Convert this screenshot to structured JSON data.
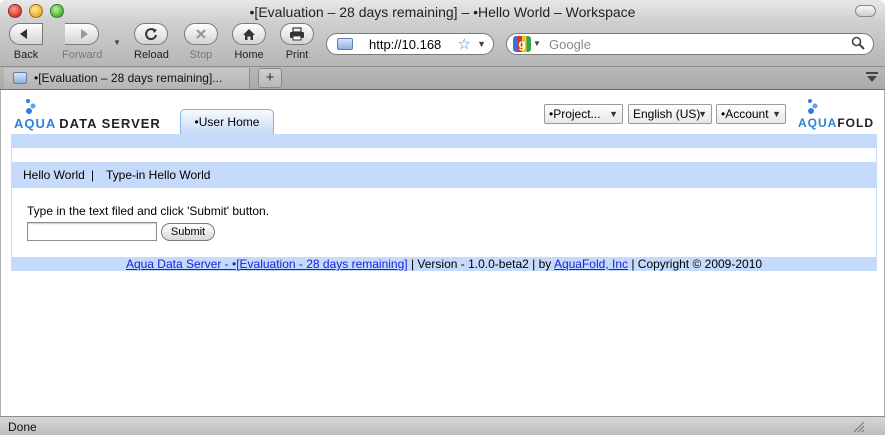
{
  "window": {
    "title": "•[Evaluation – 28 days remaining] – •Hello World – Workspace"
  },
  "toolbar": {
    "back_label": "Back",
    "forward_label": "Forward",
    "reload_label": "Reload",
    "stop_label": "Stop",
    "home_label": "Home",
    "print_label": "Print"
  },
  "address": {
    "url": "http://10.168"
  },
  "search": {
    "placeholder": "Google",
    "engine_letter": "g"
  },
  "tabs": [
    {
      "label": "•[Evaluation – 28 days remaining]..."
    }
  ],
  "newtab_label": "+",
  "app": {
    "logo_left": {
      "part1": "AQUA",
      "part2": "DATA SERVER"
    },
    "logo_right": {
      "part1": "AQUA",
      "part2": "FOLD"
    },
    "user_home_tab": "•User Home",
    "project_select": "•Project...",
    "language_select": "English (US)",
    "account_select": "•Account",
    "nav": {
      "link1": "Hello World",
      "separator": "|",
      "link2": "Type-in Hello World"
    },
    "form": {
      "instruction": "Type in the text filed and click 'Submit' button.",
      "input_value": "",
      "submit_label": "Submit"
    },
    "footer": {
      "product_link": "Aqua Data Server - •[Evaluation - 28 days remaining]",
      "version_text": " | Version - 1.0.0-beta2 | by ",
      "company_link": "AquaFold, Inc",
      "copyright_text": " | Copyright © 2009-2010"
    }
  },
  "status": {
    "text": "Done"
  },
  "colors": {
    "band": "#c6dbfb",
    "link": "#1a1ae0",
    "brand_blue": "#2f80d6"
  }
}
